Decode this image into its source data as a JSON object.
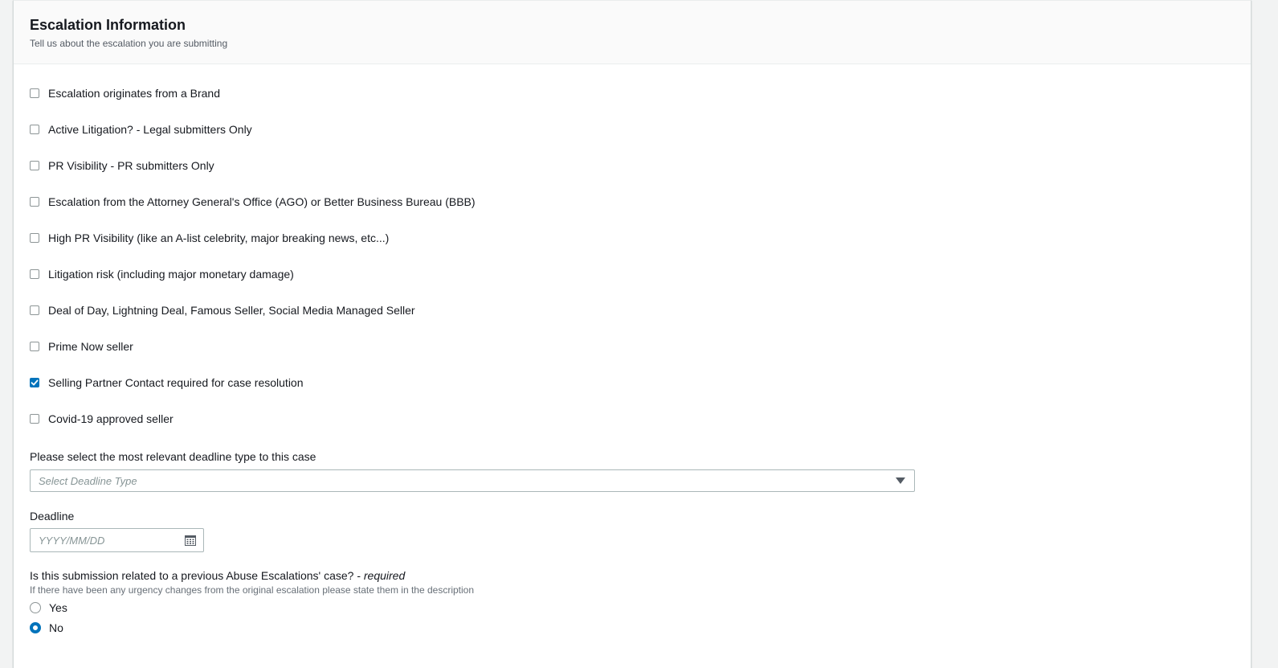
{
  "section": {
    "title": "Escalation Information",
    "description": "Tell us about the escalation you are submitting"
  },
  "checkboxes": [
    {
      "label": "Escalation originates from a Brand",
      "checked": false
    },
    {
      "label": "Active Litigation? - Legal submitters Only",
      "checked": false
    },
    {
      "label": "PR Visibility - PR submitters Only",
      "checked": false
    },
    {
      "label": "Escalation from the Attorney General's Office (AGO) or Better Business Bureau (BBB)",
      "checked": false
    },
    {
      "label": "High PR Visibility (like an A-list celebrity, major breaking news, etc...)",
      "checked": false
    },
    {
      "label": "Litigation risk (including major monetary damage)",
      "checked": false
    },
    {
      "label": "Deal of Day, Lightning Deal, Famous Seller, Social Media Managed Seller",
      "checked": false
    },
    {
      "label": "Prime Now seller",
      "checked": false
    },
    {
      "label": "Selling Partner Contact required for case resolution",
      "checked": true
    },
    {
      "label": "Covid-19 approved seller",
      "checked": false
    }
  ],
  "deadline_type": {
    "label": "Please select the most relevant deadline type to this case",
    "placeholder": "Select Deadline Type"
  },
  "deadline": {
    "label": "Deadline",
    "placeholder": "YYYY/MM/DD"
  },
  "previous_case": {
    "question": "Is this submission related to a previous Abuse Escalations' case? - ",
    "required_label": "required",
    "help": "If there have been any urgency changes from the original escalation please state them in the description",
    "options": [
      {
        "label": "Yes",
        "selected": false
      },
      {
        "label": "No",
        "selected": true
      }
    ]
  },
  "colors": {
    "accent": "#0073bb",
    "border": "#aab7b8",
    "header_bg": "#fafafa"
  }
}
